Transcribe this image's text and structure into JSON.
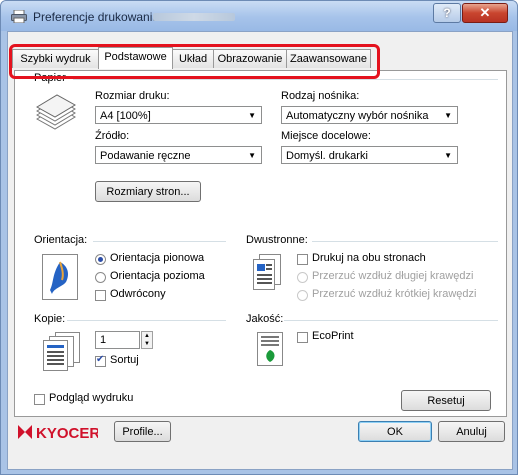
{
  "window": {
    "title": "Preferencje drukowania:",
    "help": "?",
    "close": "✕"
  },
  "tabs": [
    {
      "label": "Szybki wydruk"
    },
    {
      "label": "Podstawowe"
    },
    {
      "label": "Układ"
    },
    {
      "label": "Obrazowanie"
    },
    {
      "label": "Zaawansowane"
    }
  ],
  "paper": {
    "group_label": "Papier",
    "size_label": "Rozmiar druku:",
    "size_value": "A4  [100%]",
    "source_label": "Źródło:",
    "source_value": "Podawanie ręczne",
    "media_label": "Rodzaj nośnika:",
    "media_value": "Automatyczny wybór nośnika",
    "dest_label": "Miejsce docelowe:",
    "dest_value": "Domyśl. drukarki",
    "sizes_button": "Rozmiary stron..."
  },
  "orientation": {
    "label": "Orientacja:",
    "portrait": "Orientacja pionowa",
    "landscape": "Orientacja pozioma",
    "rotated": "Odwrócony"
  },
  "duplex": {
    "label": "Dwustronne:",
    "both_sides": "Drukuj na obu stronach",
    "long_edge": "Przerzuć wzdłuż długiej krawędzi",
    "short_edge": "Przerzuć wzdłuż krótkiej krawędzi"
  },
  "copies": {
    "label": "Kopie:",
    "value": "1",
    "collate": "Sortuj"
  },
  "quality": {
    "label": "Jakość:",
    "ecoprint": "EcoPrint"
  },
  "preview": {
    "label": "Podgląd wydruku"
  },
  "reset_button": "Resetuj",
  "footer": {
    "brand": "KYOCERA",
    "profile_button": "Profile...",
    "ok_button": "OK",
    "cancel_button": "Anuluj"
  },
  "colors": {
    "highlight": "#e4121e",
    "brand_red": "#d0112b",
    "accent": "#2d4ea8"
  }
}
